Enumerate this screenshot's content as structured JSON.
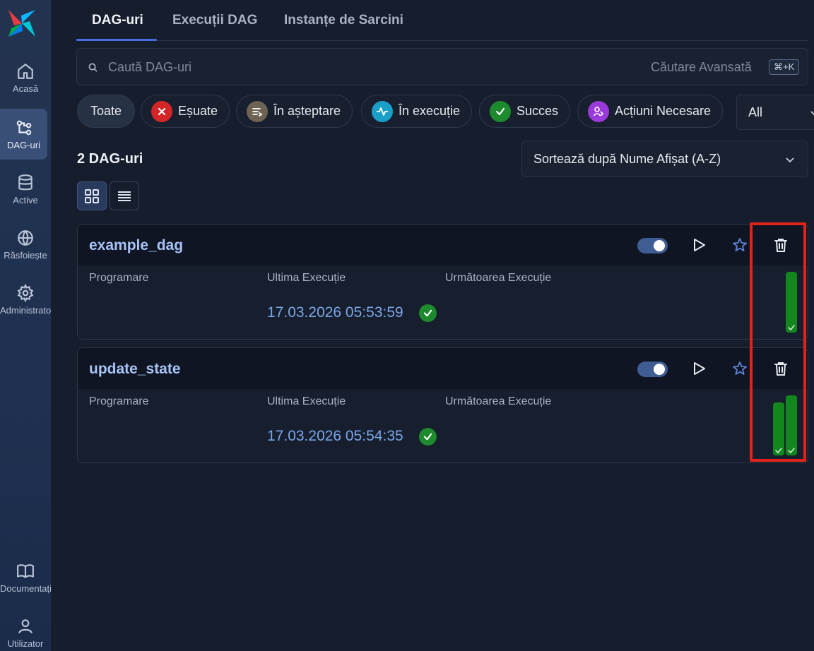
{
  "sidebar": {
    "items": [
      {
        "label": "Acasă",
        "icon": "home-icon"
      },
      {
        "label": "DAG-uri",
        "icon": "dag-icon"
      },
      {
        "label": "Active",
        "icon": "database-icon"
      },
      {
        "label": "Răsfoiește",
        "icon": "globe-icon"
      },
      {
        "label": "Administrator",
        "icon": "gear-icon"
      }
    ],
    "bottom_items": [
      {
        "label": "Documentație",
        "icon": "book-icon"
      },
      {
        "label": "Utilizator",
        "icon": "user-icon"
      }
    ]
  },
  "tabs": [
    "DAG-uri",
    "Execuții DAG",
    "Instanțe de Sarcini"
  ],
  "search": {
    "placeholder": "Caută DAG-uri",
    "advanced": "Căutare Avansată",
    "shortcut": "⌘+K"
  },
  "filters": [
    {
      "label": "Toate"
    },
    {
      "label": "Eșuate",
      "color": "#d42626"
    },
    {
      "label": "În așteptare",
      "color": "#6e6353"
    },
    {
      "label": "În execuție",
      "color": "#1aa0c8"
    },
    {
      "label": "Succes",
      "color": "#1e8a2e"
    },
    {
      "label": "Acțiuni Necesare",
      "color": "#9a3ad8"
    }
  ],
  "filter_select": "All",
  "dag_count": "2 DAG-uri",
  "sort_label": "Sortează după Nume Afișat (A-Z)",
  "columns": {
    "schedule": "Programare",
    "last_run": "Ultima Execuție",
    "next_run": "Următoarea Execuție"
  },
  "dags": [
    {
      "name": "example_dag",
      "last_run": "17.03.2026 05:53:59",
      "enabled": true,
      "run_status": "success",
      "run_bars": [
        1.0
      ]
    },
    {
      "name": "update_state",
      "last_run": "17.03.2026 05:54:35",
      "enabled": true,
      "run_status": "success",
      "run_bars": [
        0.88,
        1.0
      ]
    }
  ],
  "colors": {
    "success": "#1e8a2e",
    "accent": "#4a6ee0",
    "highlight": "#e2231a"
  }
}
